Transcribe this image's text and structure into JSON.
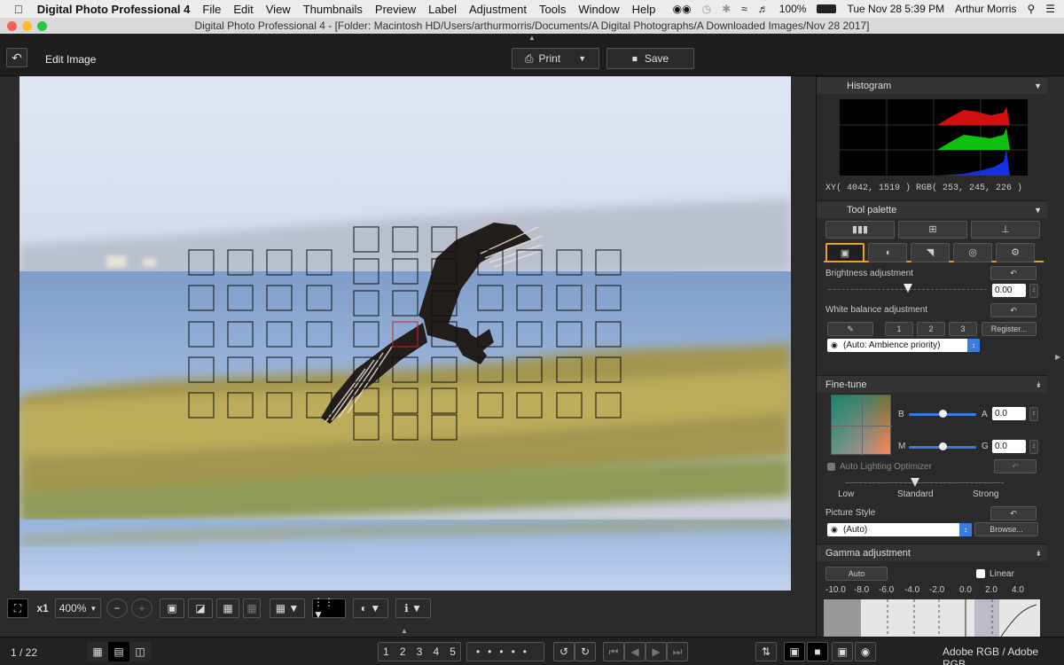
{
  "menubar": {
    "apple": "",
    "app_name": "Digital Photo Professional 4",
    "items": [
      "File",
      "Edit",
      "View",
      "Thumbnails",
      "Preview",
      "Label",
      "Adjustment",
      "Tools",
      "Window",
      "Help"
    ],
    "battery": "100%",
    "clock": "Tue Nov 28  5:39 PM",
    "user": "Arthur Morris"
  },
  "window": {
    "title": "Digital Photo Professional 4 - [Folder: Macintosh HD/Users/arthurmorris/Documents/A Digital Photographs/A Downloaded Images/Nov 28 2017]"
  },
  "toolbar": {
    "mode_label": "Edit Image",
    "print_label": "Print",
    "save_label": "Save"
  },
  "histogram": {
    "title": "Histogram",
    "readout": "XY(  4042,   1519 ) RGB( 253, 245, 226 )"
  },
  "tool_palette": {
    "title": "Tool palette",
    "brightness_label": "Brightness adjustment",
    "brightness_value": "0.00",
    "brightness_level": 0.5,
    "wb_label": "White balance adjustment",
    "wb_buttons": [
      "1",
      "2",
      "3"
    ],
    "register_label": "Register...",
    "wb_mode": "(Auto: Ambience priority)"
  },
  "fine_tune": {
    "title": "Fine-tune",
    "b_label": "B",
    "a_label": "A",
    "a_value": "0.0",
    "m_label": "M",
    "g_label": "G",
    "g_value": "0.0",
    "alo_label": "Auto Lighting Optimizer",
    "alo_levels": [
      "Low",
      "Standard",
      "Strong"
    ],
    "picture_style_label": "Picture Style",
    "picture_style_value": "(Auto)",
    "browse_label": "Browse..."
  },
  "gamma": {
    "title": "Gamma adjustment",
    "auto_label": "Auto",
    "linear_label": "Linear",
    "scale": [
      "-10.0",
      "-8.0",
      "-6.0",
      "-4.0",
      "-2.0",
      "0.0",
      "2.0",
      "4.0"
    ]
  },
  "viewer": {
    "zoom_factor": "x1",
    "zoom_percent": "400%"
  },
  "status": {
    "page_counter": "1 / 22",
    "rating_labels": [
      "1",
      "2",
      "3",
      "4",
      "5"
    ],
    "color_space": "Adobe RGB / Adobe RGB"
  },
  "colors": {
    "toolbar_bg": "#1e1e1e",
    "panel_bg": "#2a2a2a",
    "accent": "#3a7be0",
    "active_tab": "#e8a030"
  }
}
